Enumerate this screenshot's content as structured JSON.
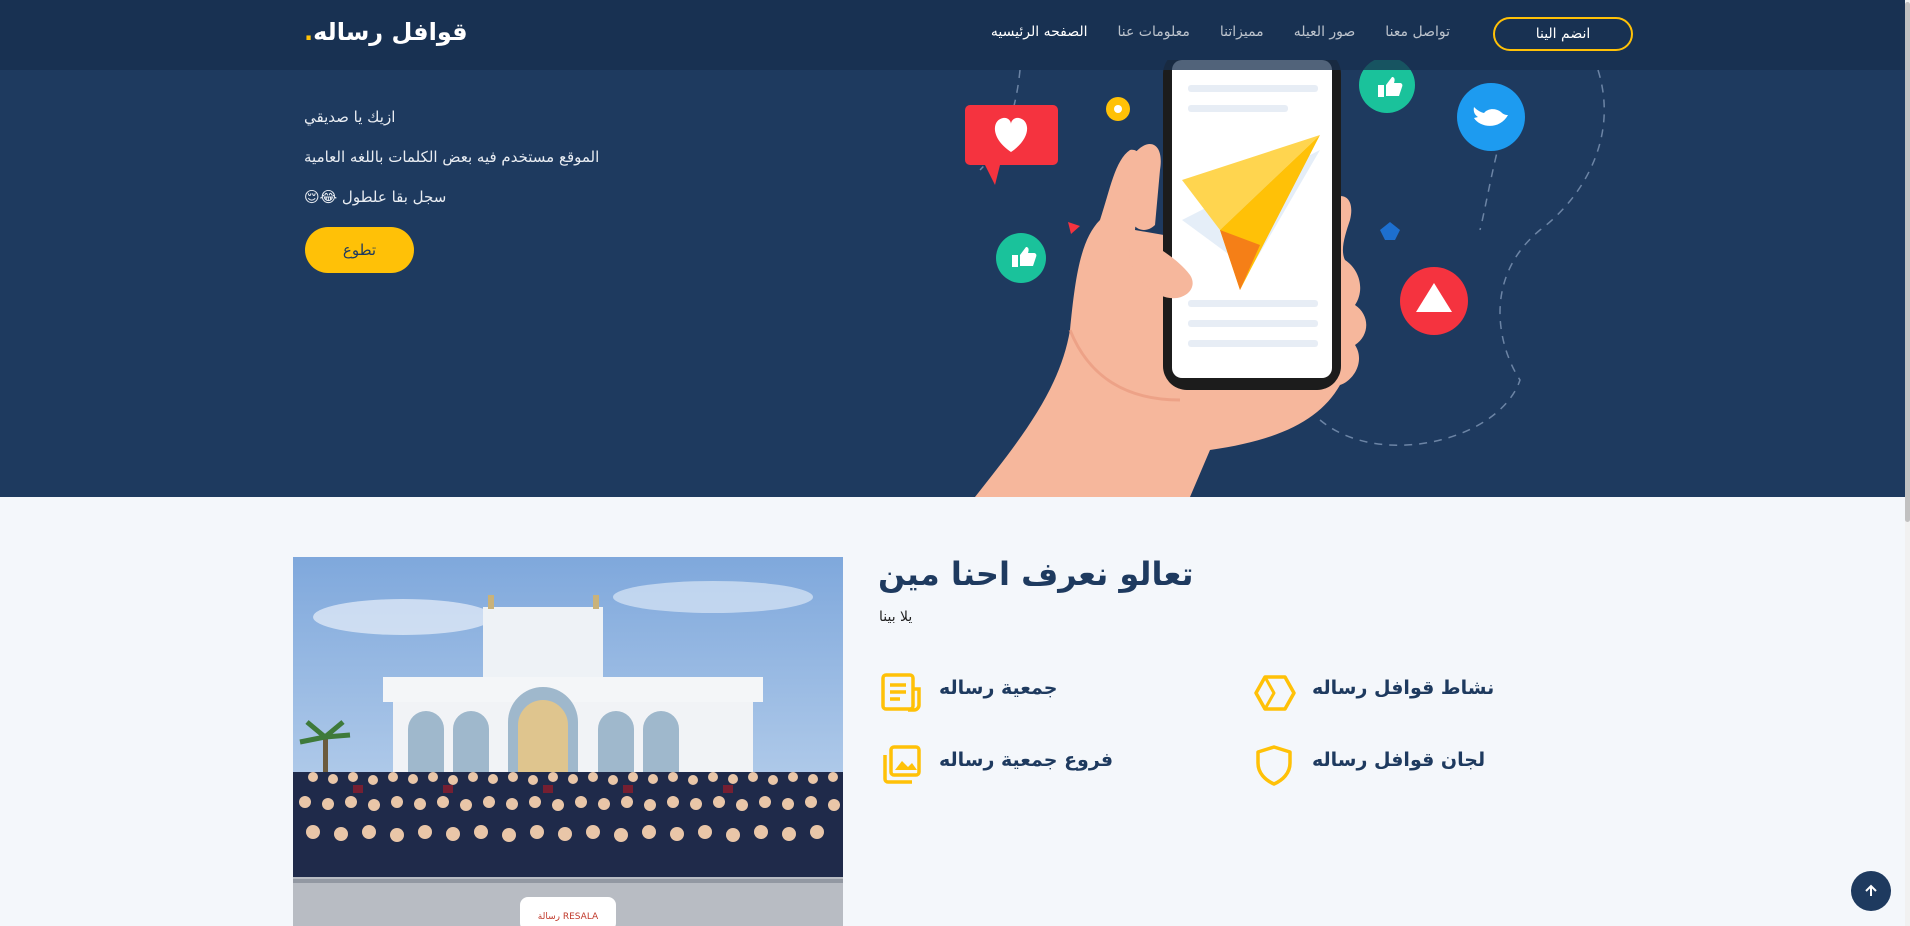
{
  "brand": {
    "name": "قوافل رساله",
    "dot": "."
  },
  "nav": {
    "items": [
      {
        "label": "الصفحه الرئيسيه",
        "active": true
      },
      {
        "label": "معلومات عنا",
        "active": false
      },
      {
        "label": "مميزاتنا",
        "active": false
      },
      {
        "label": "صور العيله",
        "active": false
      },
      {
        "label": "تواصل معنا",
        "active": false
      }
    ],
    "join_label": "انضم الينا"
  },
  "hero": {
    "line1": "ازيك يا صديقي",
    "line2": "الموقع مستخدم فيه بعض الكلمات باللغه العامية",
    "line3": "سجل بقا علطول 😂😌",
    "cta_label": "تطوع"
  },
  "about": {
    "title": "تعالو نعرف احنا مين",
    "subtitle": "يلا بينا",
    "features": [
      {
        "title": "جمعية رساله",
        "icon": "document-icon"
      },
      {
        "title": "نشاط قوافل رساله",
        "icon": "hexagon-icon"
      },
      {
        "title": "فروع جمعية رساله",
        "icon": "images-icon"
      },
      {
        "title": "لجان قوافل رساله",
        "icon": "shield-icon"
      }
    ],
    "photo_logo_text": "رسالة RESALA"
  },
  "colors": {
    "primary": "#1e3a5f",
    "accent": "#ffc107",
    "background": "#f4f7fb"
  }
}
